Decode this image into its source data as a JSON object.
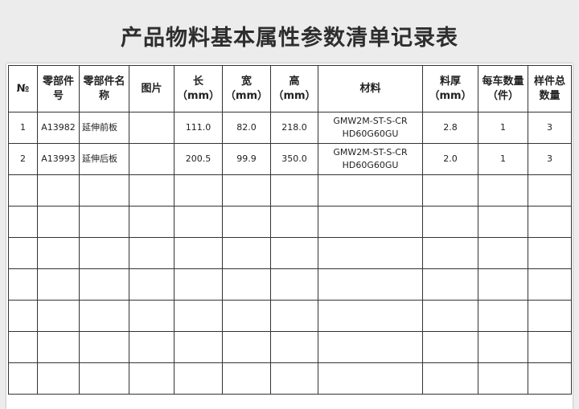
{
  "title": "产品物料基本属性参数清单记录表",
  "headers": {
    "no": "№",
    "part_no": [
      "零部件",
      "号"
    ],
    "part_name": [
      "零部件名",
      "称"
    ],
    "picture": "图片",
    "length": [
      "长",
      "（mm）"
    ],
    "width": [
      "宽",
      "（mm）"
    ],
    "height": [
      "高",
      "（mm）"
    ],
    "material": "材料",
    "thickness": [
      "料厚",
      "（mm）"
    ],
    "qty_per_car": [
      "每车数量",
      "（件）"
    ],
    "sample_total": [
      "样件总",
      "数量"
    ]
  },
  "rows": [
    {
      "no": "1",
      "part_no": "A13982",
      "part_name": "延伸前板",
      "picture": "",
      "length": "111.0",
      "width": "82.0",
      "height": "218.0",
      "material": [
        "GMW2M-ST-S-CR",
        "HD60G60GU"
      ],
      "thickness": "2.8",
      "qty_per_car": "1",
      "sample_total": "3"
    },
    {
      "no": "2",
      "part_no": "A13993",
      "part_name": "延伸后板",
      "picture": "",
      "length": "200.5",
      "width": "99.9",
      "height": "350.0",
      "material": [
        "GMW2M-ST-S-CR",
        "HD60G60GU"
      ],
      "thickness": "2.0",
      "qty_per_car": "1",
      "sample_total": "3"
    }
  ],
  "empty_rows": 7
}
